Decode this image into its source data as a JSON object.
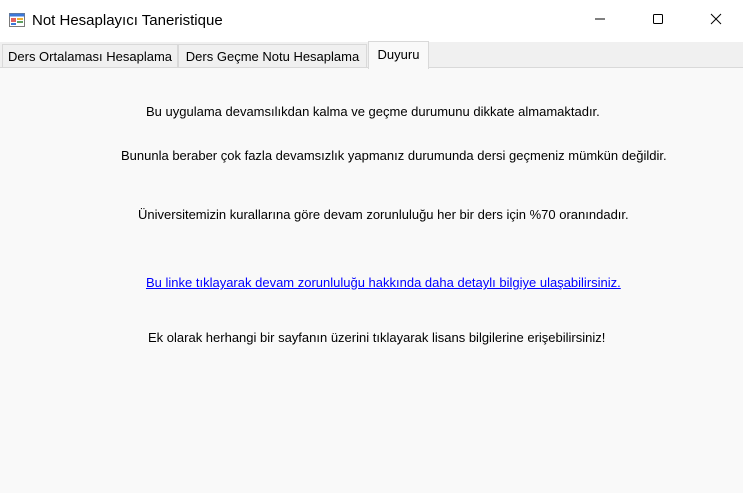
{
  "window": {
    "title": "Not Hesaplayıcı Taneristique",
    "icon": "app-form-icon",
    "controls": {
      "minimize_icon": "minimize-icon",
      "maximize_icon": "maximize-icon",
      "close_icon": "close-icon"
    }
  },
  "tabs": [
    {
      "label": "Ders Ortalaması Hesaplama"
    },
    {
      "label": "Ders Geçme Notu Hesaplama"
    },
    {
      "label": "Duyuru",
      "selected": true
    }
  ],
  "announcement": {
    "line1": "Bu uygulama devamsılıkdan kalma ve geçme durumunu dikkate almamaktadır.",
    "line2": "Bununla beraber çok fazla devamsızlık yapmanız durumunda dersi geçmeniz mümkün değildir.",
    "line3": "Üniversitemizin kurallarına göre devam zorunluluğu her bir ders için %70 oranındadır.",
    "link": "Bu linke tıklayarak devam zorunluluğu hakkında daha detaylı bilgiye ulaşabilirsiniz.",
    "line5": "Ek olarak herhangi bir sayfanın üzerini tıklayarak lisans bilgilerine erişebilirsiniz!"
  },
  "colors": {
    "link": "#0000ff",
    "panel_background": "#f9f9f9",
    "window_background": "#f0f0f0"
  }
}
